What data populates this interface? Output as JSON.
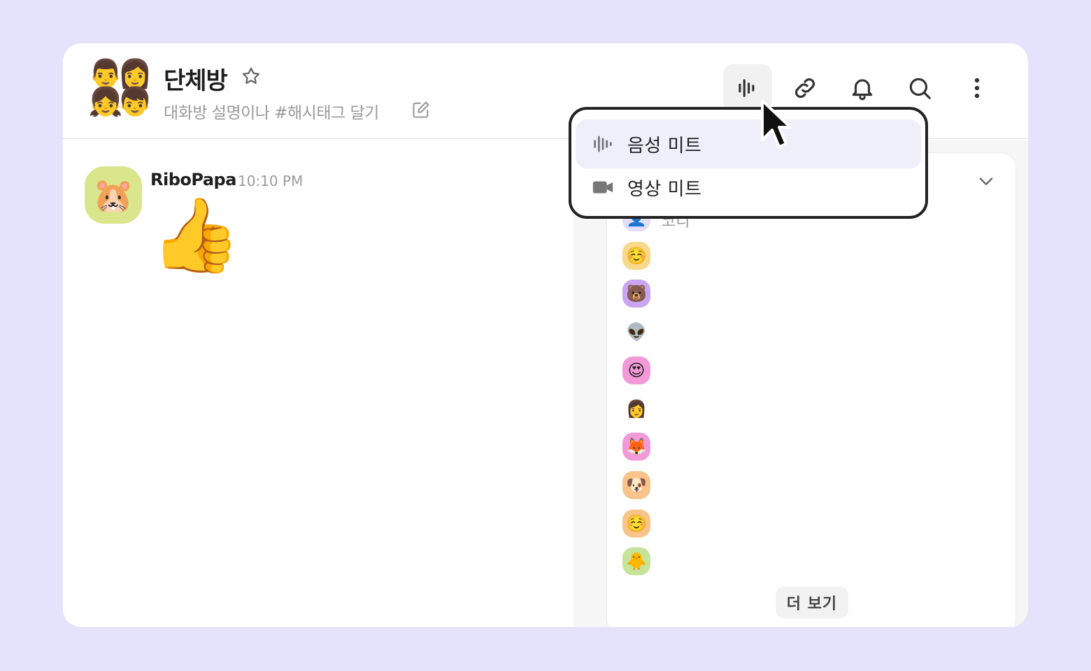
{
  "header": {
    "title": "단체방",
    "description": "대화방 설명이나 #해시태그 달기",
    "avatar_emojis": [
      "👨",
      "👩",
      "👧",
      "👦"
    ],
    "buttons": [
      "voice-meet-icon",
      "link-icon",
      "bell-icon",
      "search-icon",
      "more-vertical-icon"
    ]
  },
  "message": {
    "author": "RiboPapa",
    "time": "10:10 PM",
    "avatar_emoji": "🐹",
    "content_emoji": "👍"
  },
  "meet_menu": {
    "items": [
      {
        "label": "음성 미트",
        "icon": "voice-wave-icon",
        "highlighted": true
      },
      {
        "label": "영상 미트",
        "icon": "video-camera-icon",
        "highlighted": false
      }
    ]
  },
  "members": {
    "partial_name": "코디",
    "avatars": [
      {
        "emoji": "👤",
        "bg": "#e3ddf8"
      },
      {
        "emoji": "☺️",
        "bg": "#f8d88a"
      },
      {
        "emoji": "🐻",
        "bg": "#c9a5f2"
      },
      {
        "emoji": "👽",
        "bg": "#ffffff"
      },
      {
        "emoji": "😍",
        "bg": "#f29ad8"
      },
      {
        "emoji": "👩",
        "bg": "#ffffff"
      },
      {
        "emoji": "🦊",
        "bg": "#f29ad8"
      },
      {
        "emoji": "🐶",
        "bg": "#f8c48a"
      },
      {
        "emoji": "☺️",
        "bg": "#f8c48a"
      },
      {
        "emoji": "🐥",
        "bg": "#c6e39a"
      }
    ],
    "more_label": "더 보기"
  },
  "colors": {
    "background": "#e5e3fb",
    "popup_highlight": "#efeefb",
    "popup_border": "#222222"
  }
}
